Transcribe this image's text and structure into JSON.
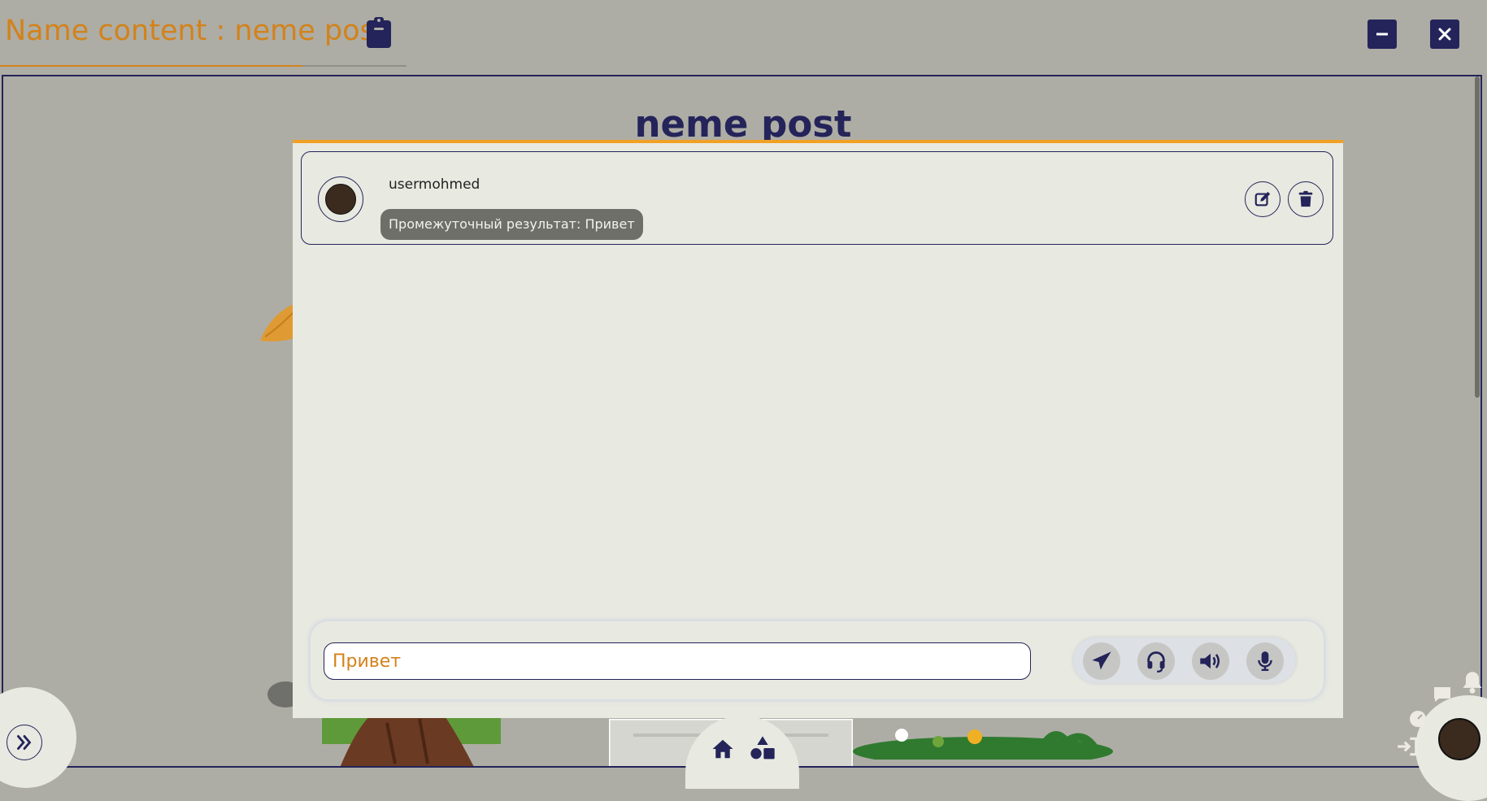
{
  "header": {
    "title": "Name content : neme post",
    "clipboard_icon": "clipboard-icon",
    "minimize_icon": "minimize-icon",
    "close_icon": "close-icon"
  },
  "post": {
    "title": "neme post"
  },
  "comment": {
    "username": "usermohmed",
    "message": "Промежуточный результат: Привет",
    "edit_icon": "edit-icon",
    "delete_icon": "trash-icon"
  },
  "composer": {
    "input_value": "Привет",
    "tools": [
      "send-icon",
      "headset-icon",
      "volume-icon",
      "microphone-icon"
    ]
  },
  "navigation": {
    "left_icon": "double-chevron-right-icon",
    "center_icons": [
      "home-icon",
      "shapes-icon"
    ],
    "right_icons": [
      "chat-icon",
      "bell-icon",
      "dashboard-icon",
      "sign-in-icon"
    ]
  },
  "colors": {
    "brand_orange": "#d3821a",
    "accent_orange": "#f0a024",
    "navy": "#24245a",
    "panel_bg": "#e8e9e0",
    "page_bg": "#adada5"
  }
}
